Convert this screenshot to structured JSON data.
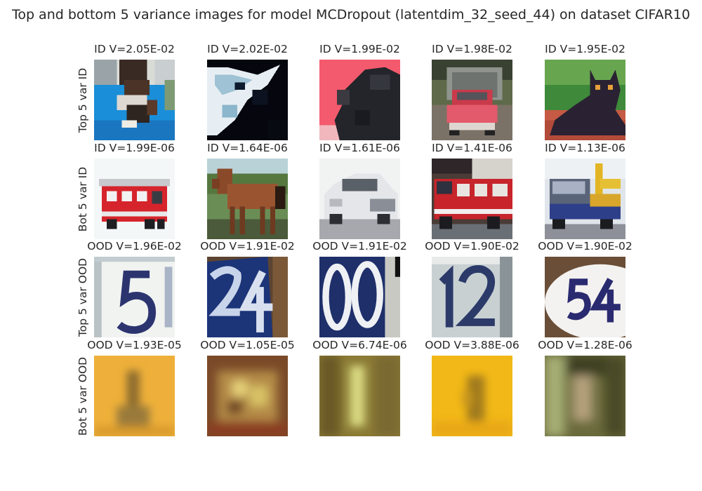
{
  "title": "Top and bottom 5 variance images for model MCDropout (latentdim_32_seed_44) on dataset CIFAR10",
  "rows": [
    {
      "label": "Top 5 var ID",
      "captions": [
        "ID V=2.05E-02",
        "ID V=2.02E-02",
        "ID V=1.99E-02",
        "ID V=1.98E-02",
        "ID V=1.95E-02"
      ],
      "images": [
        "cat-on-blue-cloth",
        "black-white-cat",
        "black-cat-pink-bg",
        "red-car-driveway",
        "black-cat-sitting"
      ]
    },
    {
      "label": "Bot 5 var ID",
      "captions": [
        "ID V=1.99E-06",
        "ID V=1.64E-06",
        "ID V=1.61E-06",
        "ID V=1.41E-06",
        "ID V=1.13E-06"
      ],
      "images": [
        "red-fire-truck",
        "brown-horse",
        "white-car",
        "fire-truck-street",
        "tow-truck"
      ]
    },
    {
      "label": "Top 5 var OOD",
      "captions": [
        "OOD V=1.96E-02",
        "OOD V=1.91E-02",
        "OOD V=1.91E-02",
        "OOD V=1.90E-02",
        "OOD V=1.90E-02"
      ],
      "images": [
        "house-number-5",
        "house-number-24",
        "house-number-00",
        "house-number-12",
        "house-number-54"
      ]
    },
    {
      "label": "Bot 5 var OOD",
      "captions": [
        "OOD V=1.93E-05",
        "OOD V=1.05E-05",
        "OOD V=6.74E-06",
        "OOD V=3.88E-06",
        "OOD V=1.28E-06"
      ],
      "images": [
        "blurry-orange-digit",
        "blurry-brown-digit",
        "blurry-olive-digit",
        "blurry-yellow-digit",
        "blurry-dark-green-digit"
      ]
    }
  ],
  "chart_data": {
    "type": "table",
    "title": "Top and bottom 5 variance images for model MCDropout (latentdim_32_seed_44) on dataset CIFAR10",
    "row_labels": [
      "Top 5 var ID",
      "Bot 5 var ID",
      "Top 5 var OOD",
      "Bot 5 var OOD"
    ],
    "values": [
      [
        0.0205,
        0.0202,
        0.0199,
        0.0198,
        0.0195
      ],
      [
        1.99e-06,
        1.64e-06,
        1.61e-06,
        1.41e-06,
        1.13e-06
      ],
      [
        0.0196,
        0.0191,
        0.0191,
        0.019,
        0.019
      ],
      [
        1.93e-05,
        1.05e-05,
        6.74e-06,
        3.88e-06,
        1.28e-06
      ]
    ]
  }
}
